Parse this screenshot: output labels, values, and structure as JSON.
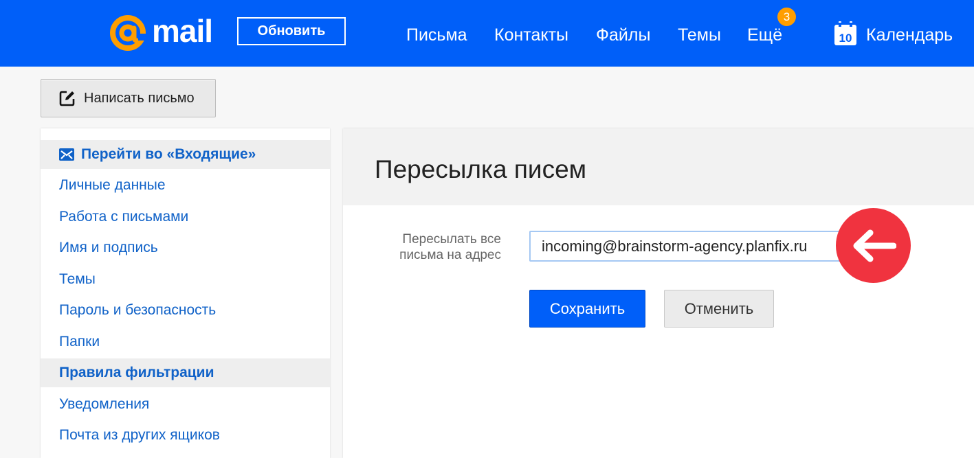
{
  "header": {
    "logo_text": "mail",
    "update_label": "Обновить",
    "nav": {
      "letters": "Письма",
      "contacts": "Контакты",
      "files": "Файлы",
      "themes": "Темы",
      "more": "Ещё",
      "more_badge": "3",
      "calendar": "Календарь",
      "calendar_day": "10"
    }
  },
  "compose": {
    "label": "Написать письмо"
  },
  "sidebar": {
    "items": [
      {
        "label": "Перейти во «Входящие»"
      },
      {
        "label": "Личные данные"
      },
      {
        "label": "Работа с письмами"
      },
      {
        "label": "Имя и подпись"
      },
      {
        "label": "Темы"
      },
      {
        "label": "Пароль и безопасность"
      },
      {
        "label": "Папки"
      },
      {
        "label": "Правила фильтрации"
      },
      {
        "label": "Уведомления"
      },
      {
        "label": "Почта из других ящиков"
      }
    ]
  },
  "main": {
    "title": "Пересылка писем",
    "forward_label": "Пересылать все письма на адрес",
    "forward_value": "incoming@brainstorm-agency.planfix.ru",
    "save_label": "Сохранить",
    "cancel_label": "Отменить"
  },
  "colors": {
    "header_bg": "#005ff9",
    "logo_at": "#ff9e00",
    "link": "#1062c8",
    "arrow_badge": "#f0333f"
  }
}
